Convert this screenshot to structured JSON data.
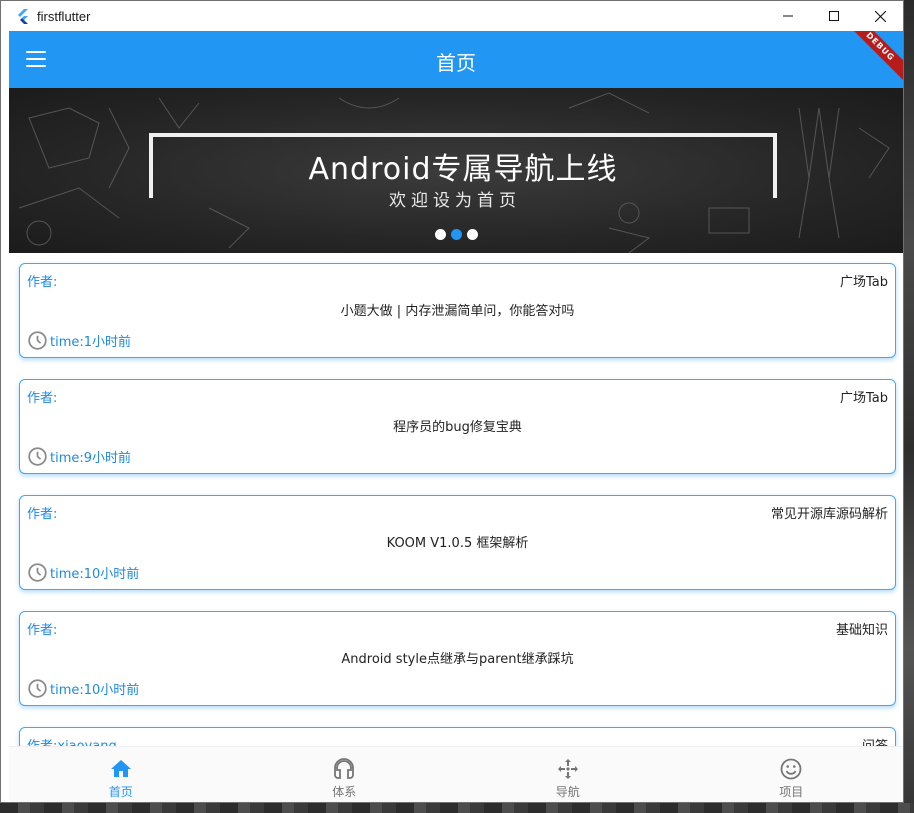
{
  "window": {
    "title": "firstflutter"
  },
  "appbar": {
    "title": "首页",
    "debug_label": "DEBUG"
  },
  "banner": {
    "title": "Android专属导航上线",
    "subtitle": "欢迎设为首页",
    "page_count": 3,
    "active_index": 1
  },
  "articles": [
    {
      "author": "作者:",
      "chapter": "广场Tab",
      "title": "小题大做 | 内存泄漏简单问，你能答对吗",
      "time": "time:1小时前"
    },
    {
      "author": "作者:",
      "chapter": "广场Tab",
      "title": "程序员的bug修复宝典",
      "time": "time:9小时前"
    },
    {
      "author": "作者:",
      "chapter": "常见开源库源码解析",
      "title": "KOOM V1.0.5 框架解析",
      "time": "time:10小时前"
    },
    {
      "author": "作者:",
      "chapter": "基础知识",
      "title": "Android style点继承与parent继承踩坑",
      "time": "time:10小时前"
    },
    {
      "author": "作者:xiaoyang",
      "chapter": "问答",
      "title": "",
      "time": ""
    }
  ],
  "bottom_nav": {
    "items": [
      {
        "label": "首页",
        "icon": "home-icon",
        "active": true
      },
      {
        "label": "体系",
        "icon": "headset-icon",
        "active": false
      },
      {
        "label": "导航",
        "icon": "move-arrows-icon",
        "active": false
      },
      {
        "label": "项目",
        "icon": "smiley-icon",
        "active": false
      }
    ]
  },
  "colors": {
    "primary": "#2196f3",
    "card_border": "#42a5f5",
    "link_text": "#1e88e5",
    "debug_ribbon": "#b71c1c"
  }
}
